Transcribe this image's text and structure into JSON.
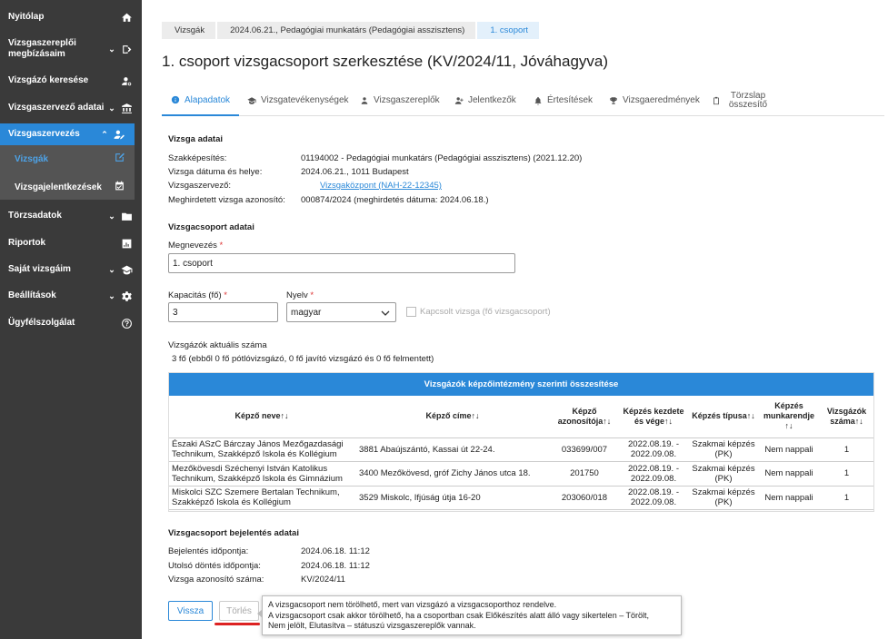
{
  "sidebar": {
    "items": [
      {
        "label": "Nyitólap",
        "icon": "home-icon"
      },
      {
        "label": "Vizsgaszereplői megbízásaim",
        "icon": "assignment-icon"
      },
      {
        "label": "Vizsgázó keresése",
        "icon": "person-search-icon"
      },
      {
        "label": "Vizsgaszervező adatai",
        "icon": "institution-icon"
      },
      {
        "label": "Vizsgaszervezés",
        "icon": "person-edit-icon"
      },
      {
        "label": "Törzsadatok",
        "icon": "folder-icon"
      },
      {
        "label": "Riportok",
        "icon": "chart-icon"
      },
      {
        "label": "Saját vizsgáim",
        "icon": "graduation-cap-icon"
      },
      {
        "label": "Beállítások",
        "icon": "gear-icon"
      },
      {
        "label": "Ügyfélszolgálat",
        "icon": "help-icon"
      }
    ],
    "submenu": [
      {
        "label": "Vizsgák",
        "icon": "edit-icon"
      },
      {
        "label": "Vizsgajelentkezések",
        "icon": "calendar-check-icon"
      }
    ]
  },
  "breadcrumb": [
    "Vizsgák",
    "2024.06.21., Pedagógiai munkatárs (Pedagógiai asszisztens)",
    "1. csoport"
  ],
  "page_title": "1. csoport vizsgacsoport szerkesztése (KV/2024/11, Jóváhagyva)",
  "tabs": [
    {
      "label": "Alapadatok"
    },
    {
      "label": "Vizsgatevékenységek"
    },
    {
      "label": "Vizsgaszereplők"
    },
    {
      "label": "Jelentkezők"
    },
    {
      "label": "Értesítések"
    },
    {
      "label": "Vizsgaeredmények"
    },
    {
      "label": "Törzslap összesítő"
    }
  ],
  "exam_data": {
    "title": "Vizsga adatai",
    "rows": [
      {
        "label": "Szakképesítés:",
        "value": "01194002 - Pedagógiai munkatárs (Pedagógiai asszisztens) (2021.12.20)"
      },
      {
        "label": "Vizsga dátuma és helye:",
        "value": "2024.06.21., 1011 Budapest"
      },
      {
        "label": "Vizsgaszervező:",
        "value": "Vizsgaközpont (NAH-22-12345)"
      },
      {
        "label": "Meghirdetett vizsga azonosító:",
        "value": "000874/2024 (meghirdetés dátuma: 2024.06.18.)"
      }
    ]
  },
  "group_data": {
    "title": "Vizsgacsoport adatai",
    "name_label": "Megnevezés",
    "name_value": "1. csoport",
    "capacity_label": "Kapacitás (fő)",
    "capacity_value": "3",
    "language_label": "Nyelv",
    "language_value": "magyar",
    "linked_label": "Kapcsolt vizsga (fő vizsgacsoport)",
    "current_count_label": "Vizsgázók aktuális száma",
    "current_count_value": "3 fő (ebből 0 fő pótlóvizsgázó, 0 fő javító vizsgázó és 0 fő felmentett)",
    "required_mark": "*"
  },
  "table": {
    "title": "Vizsgázók képzőintézmény szerinti összesítése",
    "sort_glyph": "↑↓",
    "columns": [
      "Képző neve",
      "Képző címe",
      "Képző azonosítója",
      "Képzés kezdete és vége",
      "Képzés típusa",
      "Képzés munkarendje",
      "Vizsgázók száma"
    ],
    "rows": [
      [
        "Északi ASzC Bárczay János Mezőgazdasági Technikum, Szakképző Iskola és Kollégium",
        "3881 Abaújszántó, Kassai út 22-24.",
        "033699/007",
        "2022.08.19. - 2022.09.08.",
        "Szakmai képzés (PK)",
        "Nem nappali",
        "1"
      ],
      [
        "Mezőkövesdi Széchenyi István Katolikus Technikum, Szakképző Iskola és Gimnázium",
        "3400 Mezőkövesd, gróf Zichy János utca 18.",
        "201750",
        "2022.08.19. - 2022.09.08.",
        "Szakmai képzés (PK)",
        "Nem nappali",
        "1"
      ],
      [
        "Miskolci SZC Szemere Bertalan Technikum, Szakképző Iskola és Kollégium",
        "3529 Miskolc, Ifjúság útja 16-20",
        "203060/018",
        "2022.08.19. - 2022.09.08.",
        "Szakmai képzés (PK)",
        "Nem nappali",
        "1"
      ]
    ]
  },
  "announcement": {
    "title": "Vizsgacsoport bejelentés adatai",
    "rows": [
      {
        "label": "Bejelentés időpontja:",
        "value": "2024.06.18. 11:12"
      },
      {
        "label": "Utolsó döntés időpontja:",
        "value": "2024.06.18. 11:12"
      },
      {
        "label": "Vizsga azonosító száma:",
        "value": "KV/2024/11"
      }
    ]
  },
  "buttons": {
    "back": "Vissza",
    "delete": "Törlés"
  },
  "tooltip": {
    "lines": [
      "A vizsgacsoport nem törölhető, mert van vizsgázó a vizsgacsoporthoz rendelve.",
      "A vizsgacsoport csak akkor törölhető, ha a csoportban csak Előkészítés alatt álló vagy sikertelen – Törölt,",
      "Nem jelölt, Elutasítva – státuszú vizsgaszereplők vannak."
    ]
  },
  "colors": {
    "accent": "#2a88d8",
    "sidebar": "#3a3a3a",
    "warning_line": "#dd2222"
  }
}
